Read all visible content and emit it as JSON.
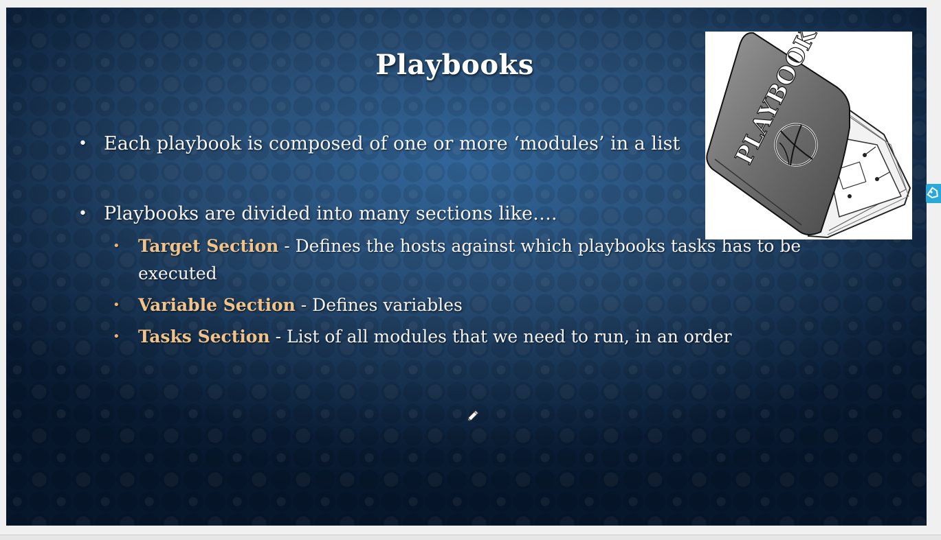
{
  "slide": {
    "title": "Playbooks",
    "bullet1": "Each playbook is composed of one or more ‘modules’ in a list",
    "bullet2": "Playbooks are divided into many sections like….",
    "sections": [
      {
        "name": "Target Section",
        "desc": " - Defines the hosts against which playbooks tasks has to be executed"
      },
      {
        "name": "Variable Section",
        "desc": " - Defines variables"
      },
      {
        "name": "Tasks Section",
        "desc": " - List of all modules that we need to run, in an order"
      }
    ],
    "image_text": "PLAYBOOK"
  },
  "colors": {
    "accent": "#f0c38b",
    "text": "#f4f4f4",
    "background": "#0d2a4a"
  },
  "icons": {
    "bullet": "•",
    "cursor": "pencil-cursor-icon",
    "side_tool": "tag-icon"
  }
}
